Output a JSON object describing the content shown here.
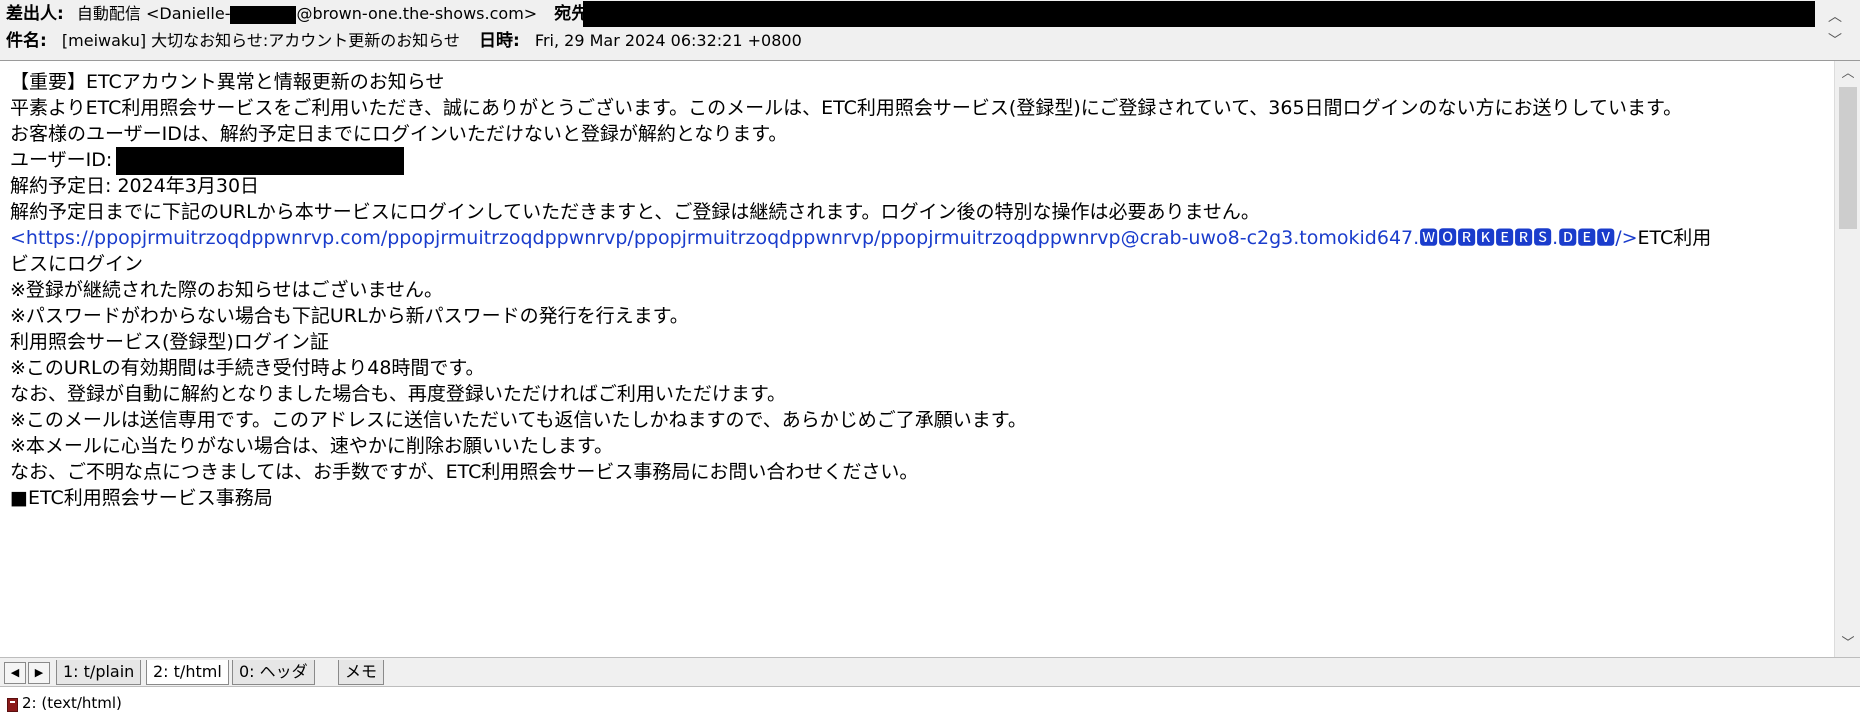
{
  "header": {
    "from_label": "差出人:",
    "from_name": "自動配信 <Danielle-",
    "from_domain": "@brown-one.the-shows.com>",
    "to_label": "宛先:",
    "subject_label": "件名:",
    "subject_value": "[meiwaku] 大切なお知らせ:アカウント更新のお知らせ",
    "date_label": "日時:",
    "date_value": "Fri, 29 Mar 2024 06:32:21 +0800"
  },
  "body": {
    "lines": [
      "【重要】ETCアカウント異常と情報更新のお知らせ",
      "平素よりETC利用照会サービスをご利用いただき、誠にありがとうございます。このメールは、ETC利用照会サービス(登録型)にご登録されていて、365日間ログインのない方にお送りしています。",
      "お客様のユーザーIDは、解約予定日までにログインいただけないと登録が解約となります。",
      "ユーザーID:",
      "解約予定日: 2024年3月30日",
      "解約予定日までに下記のURLから本サービスにログインしていただきますと、ご登録は継続されます。ログイン後の特別な操作は必要ありません。"
    ],
    "link": "<https://ppopjrmuitrzoqdppwnrvp.com/ppopjrmuitrzoqdppwnrvp/ppopjrmuitrzoqdppwnrvp/ppopjrmuitrzoqdppwnrvp@crab-uwo8-c2g3.tomokid647.🆆🅾🆁🅺🅴🆁🆂.🅳🅴🆅/>",
    "link_tail": "ETC利用",
    "wrap_line": "ビスにログイン",
    "lines2": [
      "※登録が継続された際のお知らせはございません。",
      "※パスワードがわからない場合も下記URLから新パスワードの発行を行えます。",
      "利用照会サービス(登録型)ログイン証",
      "※このURLの有効期間は手続き受付時より48時間です。",
      "なお、登録が自動に解約となりました場合も、再度登録いただければご利用いただけます。",
      "※このメールは送信専用です。このアドレスに送信いただいても返信いたしかねますので、あらかじめご了承願います。",
      "※本メールに心当たりがない場合は、速やかに削除お願いいたします。",
      "なお、ご不明な点につきましては、お手数ですが、ETC利用照会サービス事務局にお問い合わせください。",
      "■ETC利用照会サービス事務局"
    ]
  },
  "tabs": {
    "items": [
      {
        "label": "1: t/plain"
      },
      {
        "label": "2: t/html"
      },
      {
        "label": "0: ヘッダ"
      },
      {
        "label": "メモ"
      }
    ]
  },
  "status": {
    "text": "2: (text/html)"
  },
  "colors": {
    "link": "#1a3ccc",
    "header_bg": "#f0f0f0"
  }
}
